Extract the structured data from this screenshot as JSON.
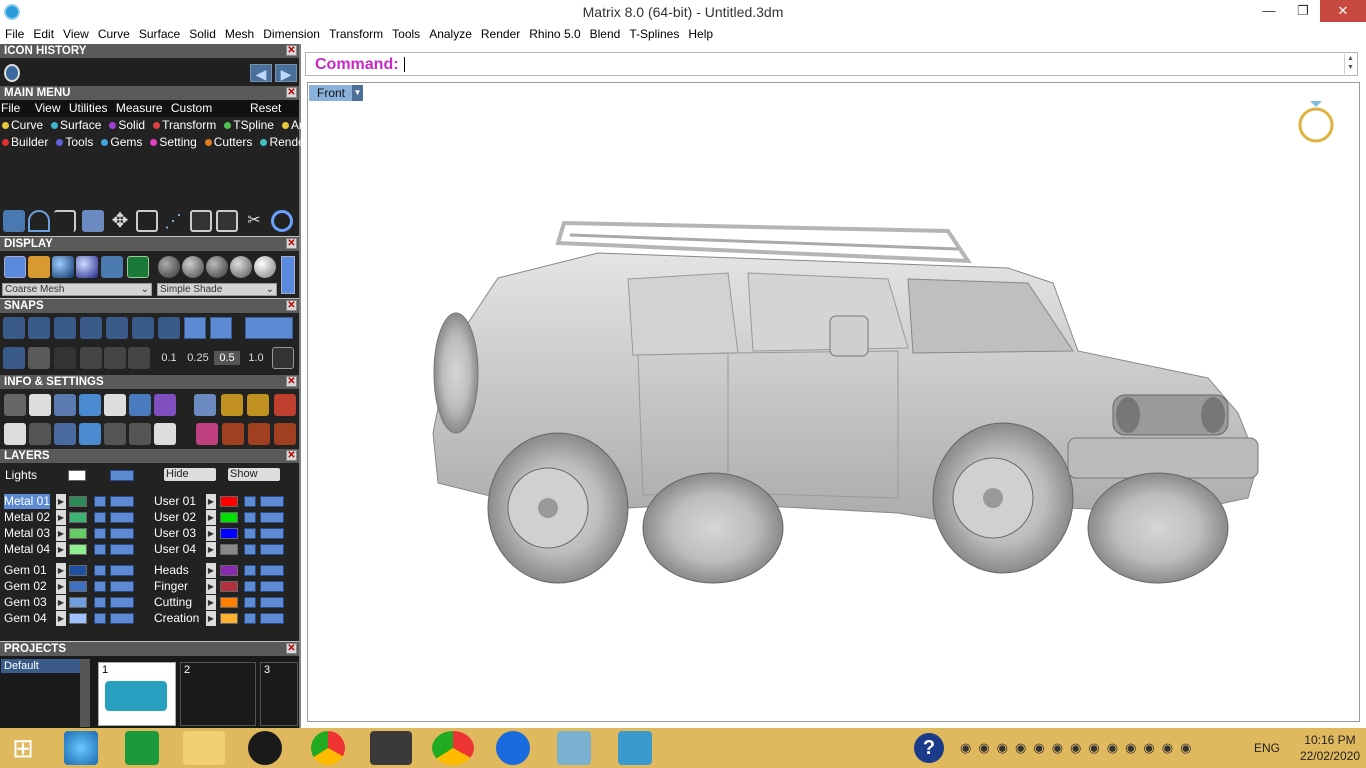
{
  "window": {
    "title": "Matrix 8.0 (64-bit) - Untitled.3dm",
    "minimize": "—",
    "restore": "❐",
    "close": "✕"
  },
  "menubar": [
    "File",
    "Edit",
    "View",
    "Curve",
    "Surface",
    "Solid",
    "Mesh",
    "Dimension",
    "Transform",
    "Tools",
    "Analyze",
    "Render",
    "Rhino 5.0",
    "Blend",
    "T-Splines",
    "Help"
  ],
  "panels": {
    "icon_history": "ICON HISTORY",
    "main_menu": "MAIN MENU",
    "display": "DISPLAY",
    "snaps": "SNAPS",
    "info_settings": "INFO & SETTINGS",
    "layers": "LAYERS",
    "projects": "PROJECTS"
  },
  "main_menu": {
    "top_items": [
      "File",
      "View",
      "Utilities",
      "Measure",
      "Custom"
    ],
    "reset": "Reset",
    "row1": [
      {
        "label": "Curve",
        "color": "#e8c93a"
      },
      {
        "label": "Surface",
        "color": "#3ab7c9"
      },
      {
        "label": "Solid",
        "color": "#a040d8"
      },
      {
        "label": "Transform",
        "color": "#e04040"
      },
      {
        "label": "TSpline",
        "color": "#50c050"
      },
      {
        "label": "Art",
        "color": "#e8c93a"
      }
    ],
    "row2": [
      {
        "label": "Builder",
        "color": "#e03030"
      },
      {
        "label": "Tools",
        "color": "#6060e0"
      },
      {
        "label": "Gems",
        "color": "#40a0e0"
      },
      {
        "label": "Setting",
        "color": "#e040c0"
      },
      {
        "label": "Cutters",
        "color": "#e08020"
      },
      {
        "label": "Render",
        "color": "#40c0c0"
      }
    ]
  },
  "display": {
    "mesh_select": "Coarse Mesh",
    "shade_select": "Simple Shade"
  },
  "snaps": {
    "values": [
      "0.1",
      "0.25",
      "0.5",
      "1.0"
    ]
  },
  "layers": {
    "lights": "Lights",
    "hide": "Hide",
    "show": "Show",
    "left": [
      {
        "name": "Metal 01",
        "color": "#2e8b57"
      },
      {
        "name": "Metal 02",
        "color": "#3cb371"
      },
      {
        "name": "Metal 03",
        "color": "#66cc66"
      },
      {
        "name": "Metal 04",
        "color": "#90ee90"
      },
      {
        "name": "Gem 01",
        "color": "#1f4fa0"
      },
      {
        "name": "Gem 02",
        "color": "#3f6fc0"
      },
      {
        "name": "Gem 03",
        "color": "#6f9fe0"
      },
      {
        "name": "Gem 04",
        "color": "#9fbfff"
      }
    ],
    "right": [
      {
        "name": "User 01",
        "color": "#ff0000"
      },
      {
        "name": "User 02",
        "color": "#00e000"
      },
      {
        "name": "User 03",
        "color": "#0000ff"
      },
      {
        "name": "User 04",
        "color": "#888888"
      },
      {
        "name": "Heads",
        "color": "#8a2ab0"
      },
      {
        "name": "Finger",
        "color": "#b03040"
      },
      {
        "name": "Cutting",
        "color": "#ff7f00"
      },
      {
        "name": "Creation",
        "color": "#ffb030"
      }
    ]
  },
  "projects": {
    "default": "Default",
    "slots": [
      "1",
      "2",
      "3"
    ]
  },
  "command": {
    "label": "Command:"
  },
  "viewport": {
    "name": "Front"
  },
  "tray": {
    "lang": "ENG",
    "time": "10:16 PM",
    "date": "22/02/2020"
  }
}
